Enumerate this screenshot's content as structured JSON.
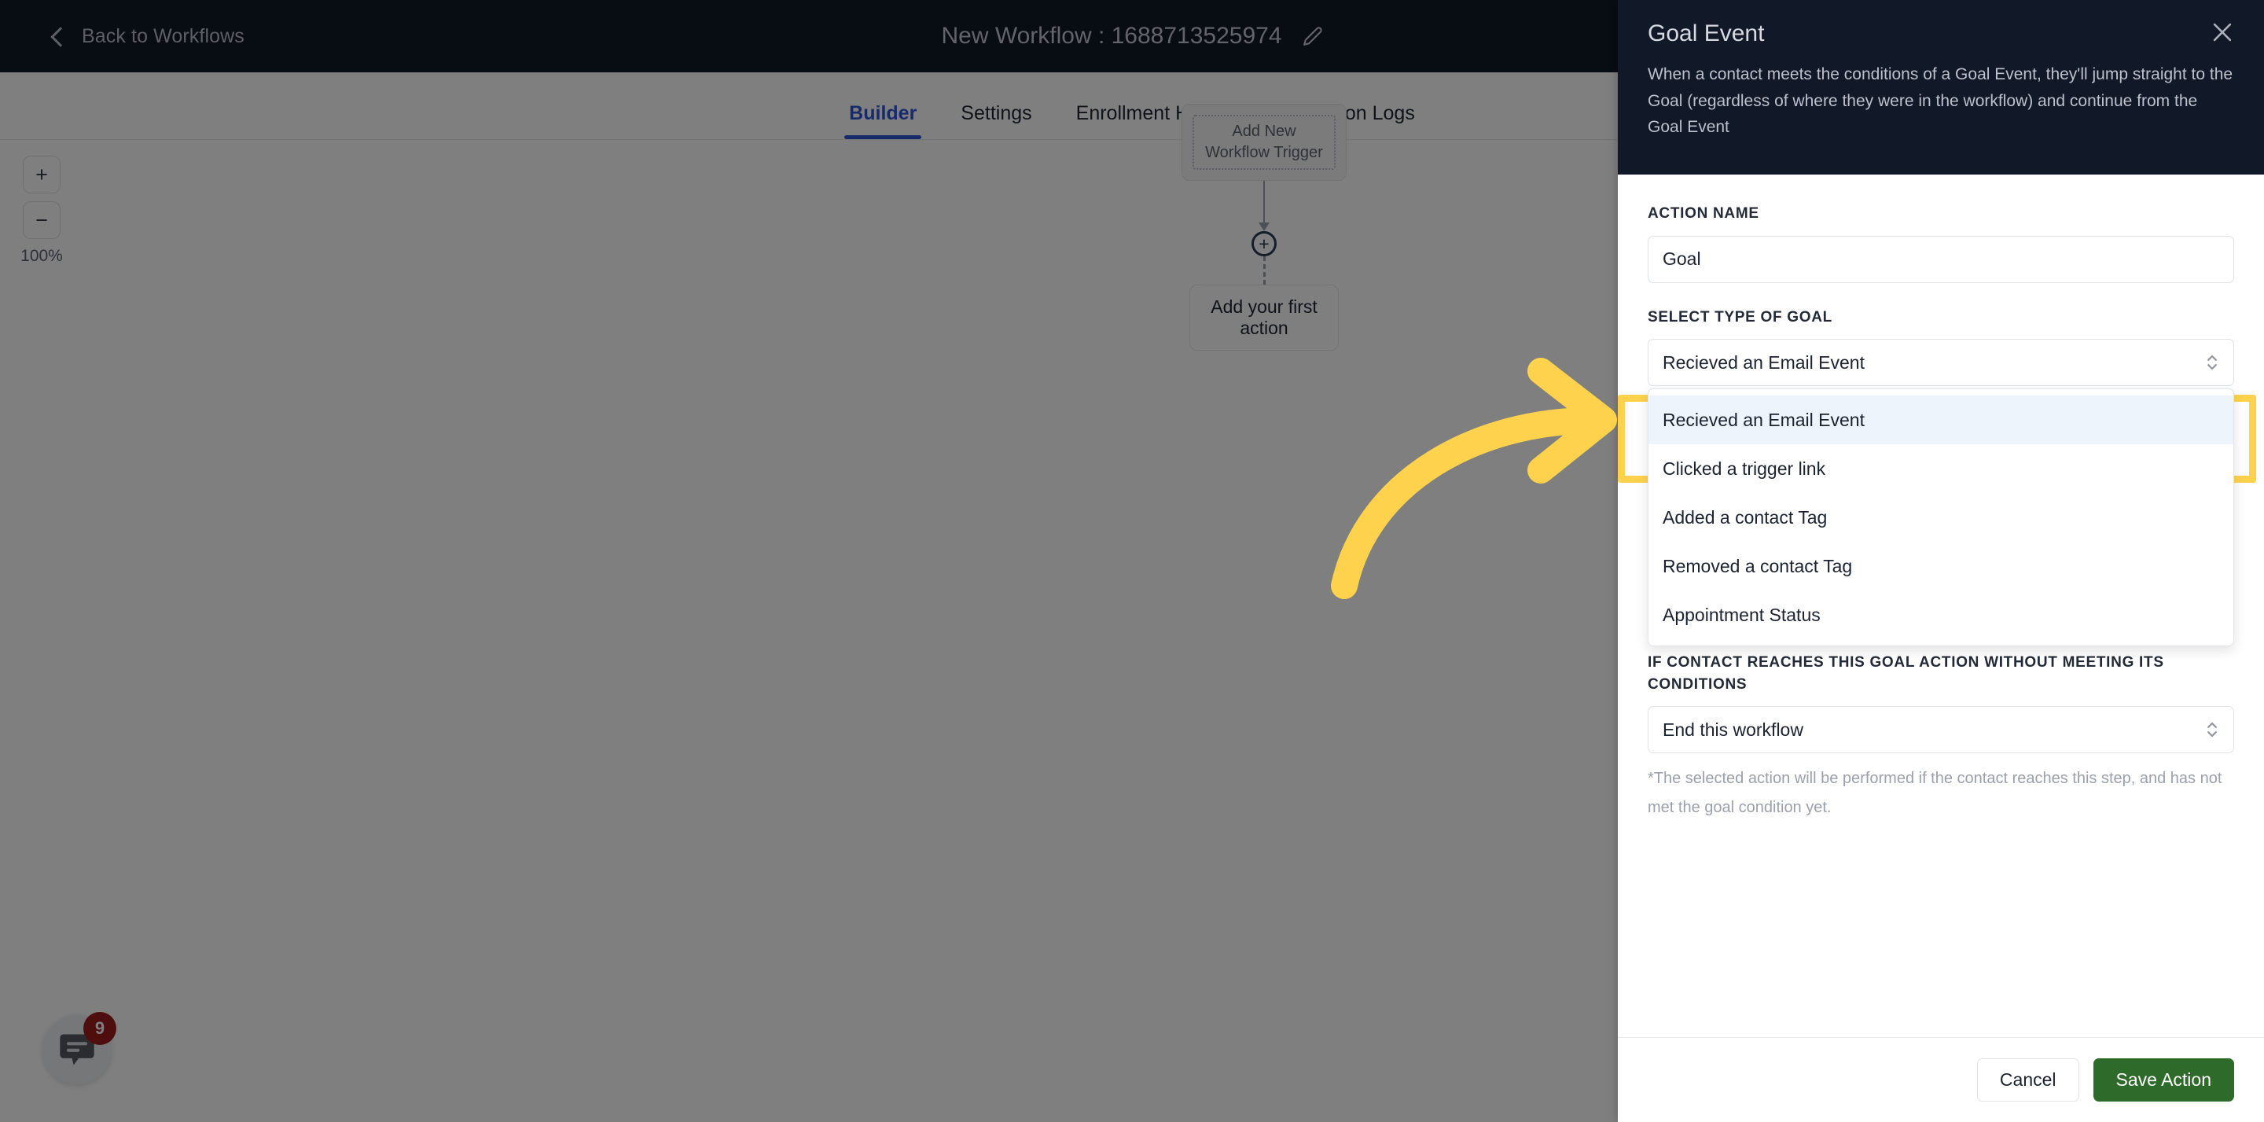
{
  "topbar": {
    "back_label": "Back to Workflows",
    "workflow_title": "New Workflow : 1688713525974",
    "edit_icon": "pencil-icon"
  },
  "tabs": [
    {
      "label": "Builder",
      "active": true
    },
    {
      "label": "Settings",
      "active": false
    },
    {
      "label": "Enrollment History",
      "active": false
    },
    {
      "label": "Execution Logs",
      "active": false
    }
  ],
  "canvas": {
    "zoom": {
      "plus_label": "+",
      "minus_label": "−",
      "level": "100%"
    },
    "trigger_card_label": "Add New Workflow Trigger",
    "plus_node_label": "+",
    "first_action_label": "Add your first action",
    "chat_widget": {
      "badge_count": "9",
      "icon": "chat-bubble-icon"
    }
  },
  "panel": {
    "title": "Goal Event",
    "close_icon": "close-icon",
    "description": "When a contact meets the conditions of a Goal Event, they'll jump straight to the Goal (regardless of where they were in the workflow) and continue from the Goal Event",
    "action_name": {
      "label": "ACTION NAME",
      "value": "Goal",
      "placeholder": "Action Name"
    },
    "goal_type": {
      "label": "SELECT TYPE OF GOAL",
      "value": "Recieved an Email Event",
      "options": [
        "Recieved an Email Event",
        "Clicked a trigger link",
        "Added a contact Tag",
        "Removed a contact Tag",
        "Appointment Status"
      ],
      "selected_index": 0
    },
    "fallback": {
      "label": "IF CONTACT REACHES THIS GOAL ACTION WITHOUT MEETING ITS CONDITIONS",
      "value": "End this workflow",
      "hint": "*The selected action will be performed if the contact reaches this step, and has not met the goal condition yet."
    },
    "footer": {
      "cancel_label": "Cancel",
      "save_label": "Save Action"
    }
  },
  "annotation": {
    "highlight_color": "#ffd24d",
    "arrow_color": "#ffd24d",
    "arrow_icon": "curved-arrow-right-icon"
  },
  "colors": {
    "header_dark": "#111827",
    "accent_blue": "#2f55d4",
    "save_green": "#2e6b2b",
    "badge_red": "#9c1d1d",
    "highlight_yellow": "#ffd24d",
    "selected_row": "#edf4fb"
  }
}
